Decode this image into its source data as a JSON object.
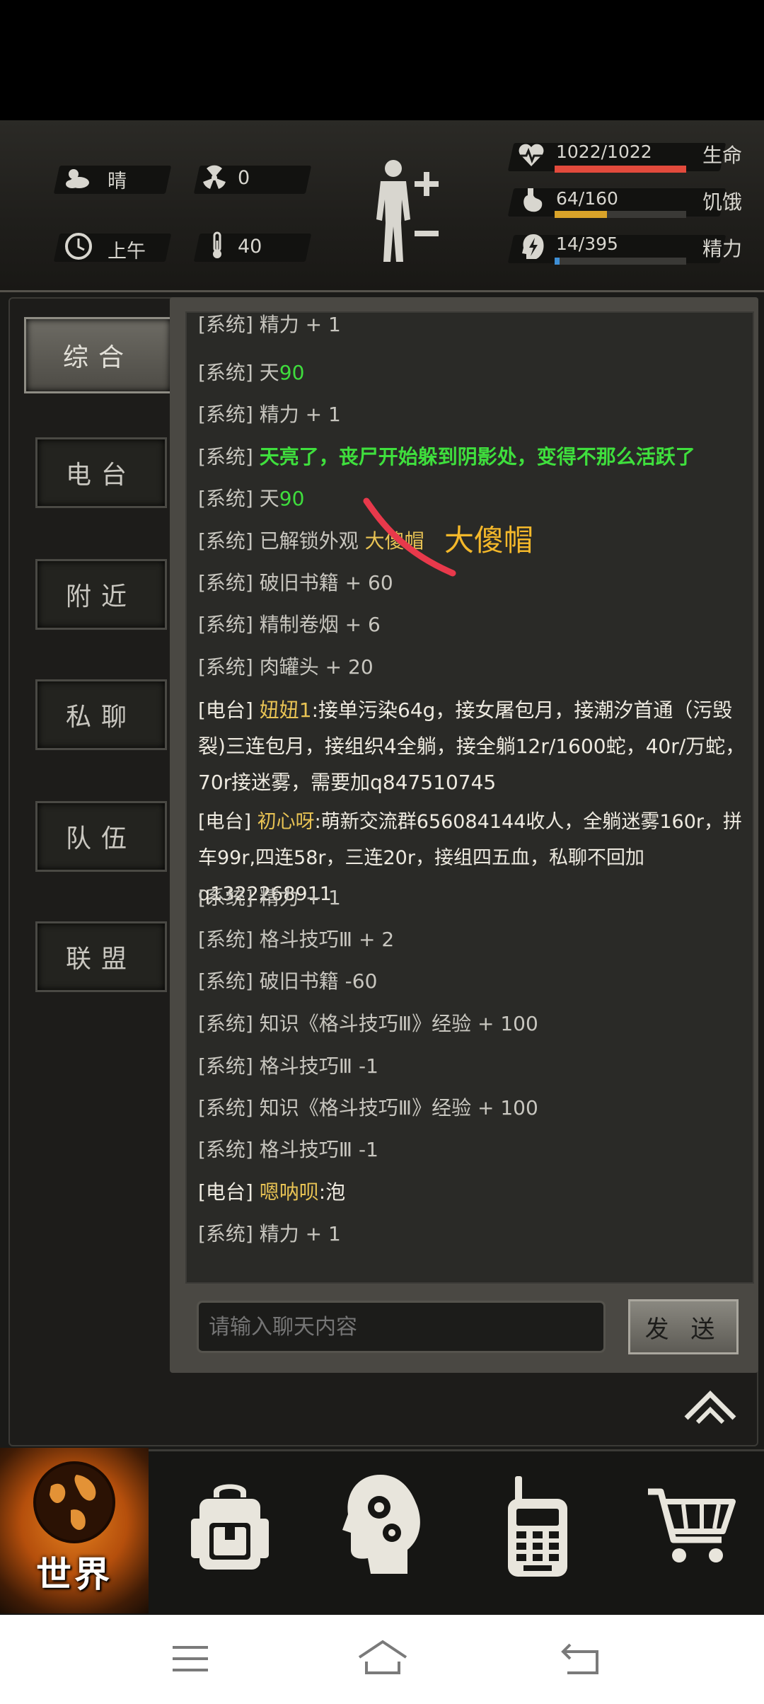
{
  "hud": {
    "weather": "晴",
    "radiation": "0",
    "time_of_day": "上午",
    "temperature": "40",
    "life_value": "1022/1022",
    "life_label": "生命",
    "life_fraction": 1.0,
    "hunger_value": "64/160",
    "hunger_label": "饥饿",
    "hunger_fraction": 0.4,
    "energy_value": "14/395",
    "energy_label": "精力",
    "energy_fraction": 0.035,
    "colors": {
      "life": "#e24a3c",
      "hunger": "#d9a329",
      "energy": "#3e8fd6"
    }
  },
  "tabs": [
    "综合",
    "电台",
    "附近",
    "私聊",
    "队伍",
    "联盟"
  ],
  "active_tab": "综合",
  "messages": [
    {
      "prefix": "[系统]",
      "text": "精力 + 1",
      "style": "normal"
    },
    {
      "prefix": "[系统]",
      "text": "天",
      "accent": "90",
      "style": "day"
    },
    {
      "prefix": "[系统]",
      "text": "精力 + 1",
      "style": "normal"
    },
    {
      "prefix": "[系统]",
      "text": "天亮了，丧尸开始躲到阴影处，变得不那么活跃了",
      "style": "green"
    },
    {
      "prefix": "[系统]",
      "text": "天",
      "accent": "90",
      "style": "day"
    },
    {
      "prefix": "[系统]",
      "text": "已解锁外观 ",
      "accent": "大傻帽",
      "style": "unlock"
    },
    {
      "prefix": "[系统]",
      "text": "破旧书籍 + 60",
      "style": "normal"
    },
    {
      "prefix": "[系统]",
      "text": "精制卷烟 + 6",
      "style": "normal"
    },
    {
      "prefix": "[系统]",
      "text": "肉罐头 + 20",
      "style": "normal"
    },
    {
      "prefix": "[电台]",
      "sender": "妞妞1",
      "text": ":接单污染64g，接女屠包月，接潮汐首通（污毁裂)三连包月，接组织4全躺，接全躺12r/1600蛇，40r/万蛇，70r接迷雾，需要加q847510745",
      "style": "radio"
    },
    {
      "prefix": "[电台]",
      "sender": "初心呀",
      "text": ":萌新交流群656084144收人，全躺迷雾160r，拼车99r,四连58r，三连20r，接组四五血，私聊不回加q1322268911",
      "style": "radio"
    },
    {
      "prefix": "[系统]",
      "text": "精力 + 1",
      "style": "normal"
    },
    {
      "prefix": "[系统]",
      "text": "格斗技巧Ⅲ + 2",
      "style": "normal"
    },
    {
      "prefix": "[系统]",
      "text": "破旧书籍 -60",
      "style": "normal"
    },
    {
      "prefix": "[系统]",
      "text": "知识《格斗技巧Ⅲ》经验 + 100",
      "style": "normal"
    },
    {
      "prefix": "[系统]",
      "text": "格斗技巧Ⅲ -1",
      "style": "normal"
    },
    {
      "prefix": "[系统]",
      "text": "知识《格斗技巧Ⅲ》经验 + 100",
      "style": "normal"
    },
    {
      "prefix": "[系统]",
      "text": "格斗技巧Ⅲ -1",
      "style": "normal"
    },
    {
      "prefix": "[电台]",
      "sender": "嗯呐呗",
      "text": ":泡",
      "style": "radio"
    },
    {
      "prefix": "[系统]",
      "text": "精力 + 1",
      "style": "normal"
    }
  ],
  "annotation": "大傻帽",
  "input": {
    "placeholder": "请输入聊天内容"
  },
  "send_label": "发 送",
  "bottom_nav": {
    "world_label": "世界",
    "items": [
      "world-globe-icon",
      "backpack-icon",
      "head-gears-icon",
      "walkie-talkie-icon",
      "cart-icon"
    ]
  }
}
